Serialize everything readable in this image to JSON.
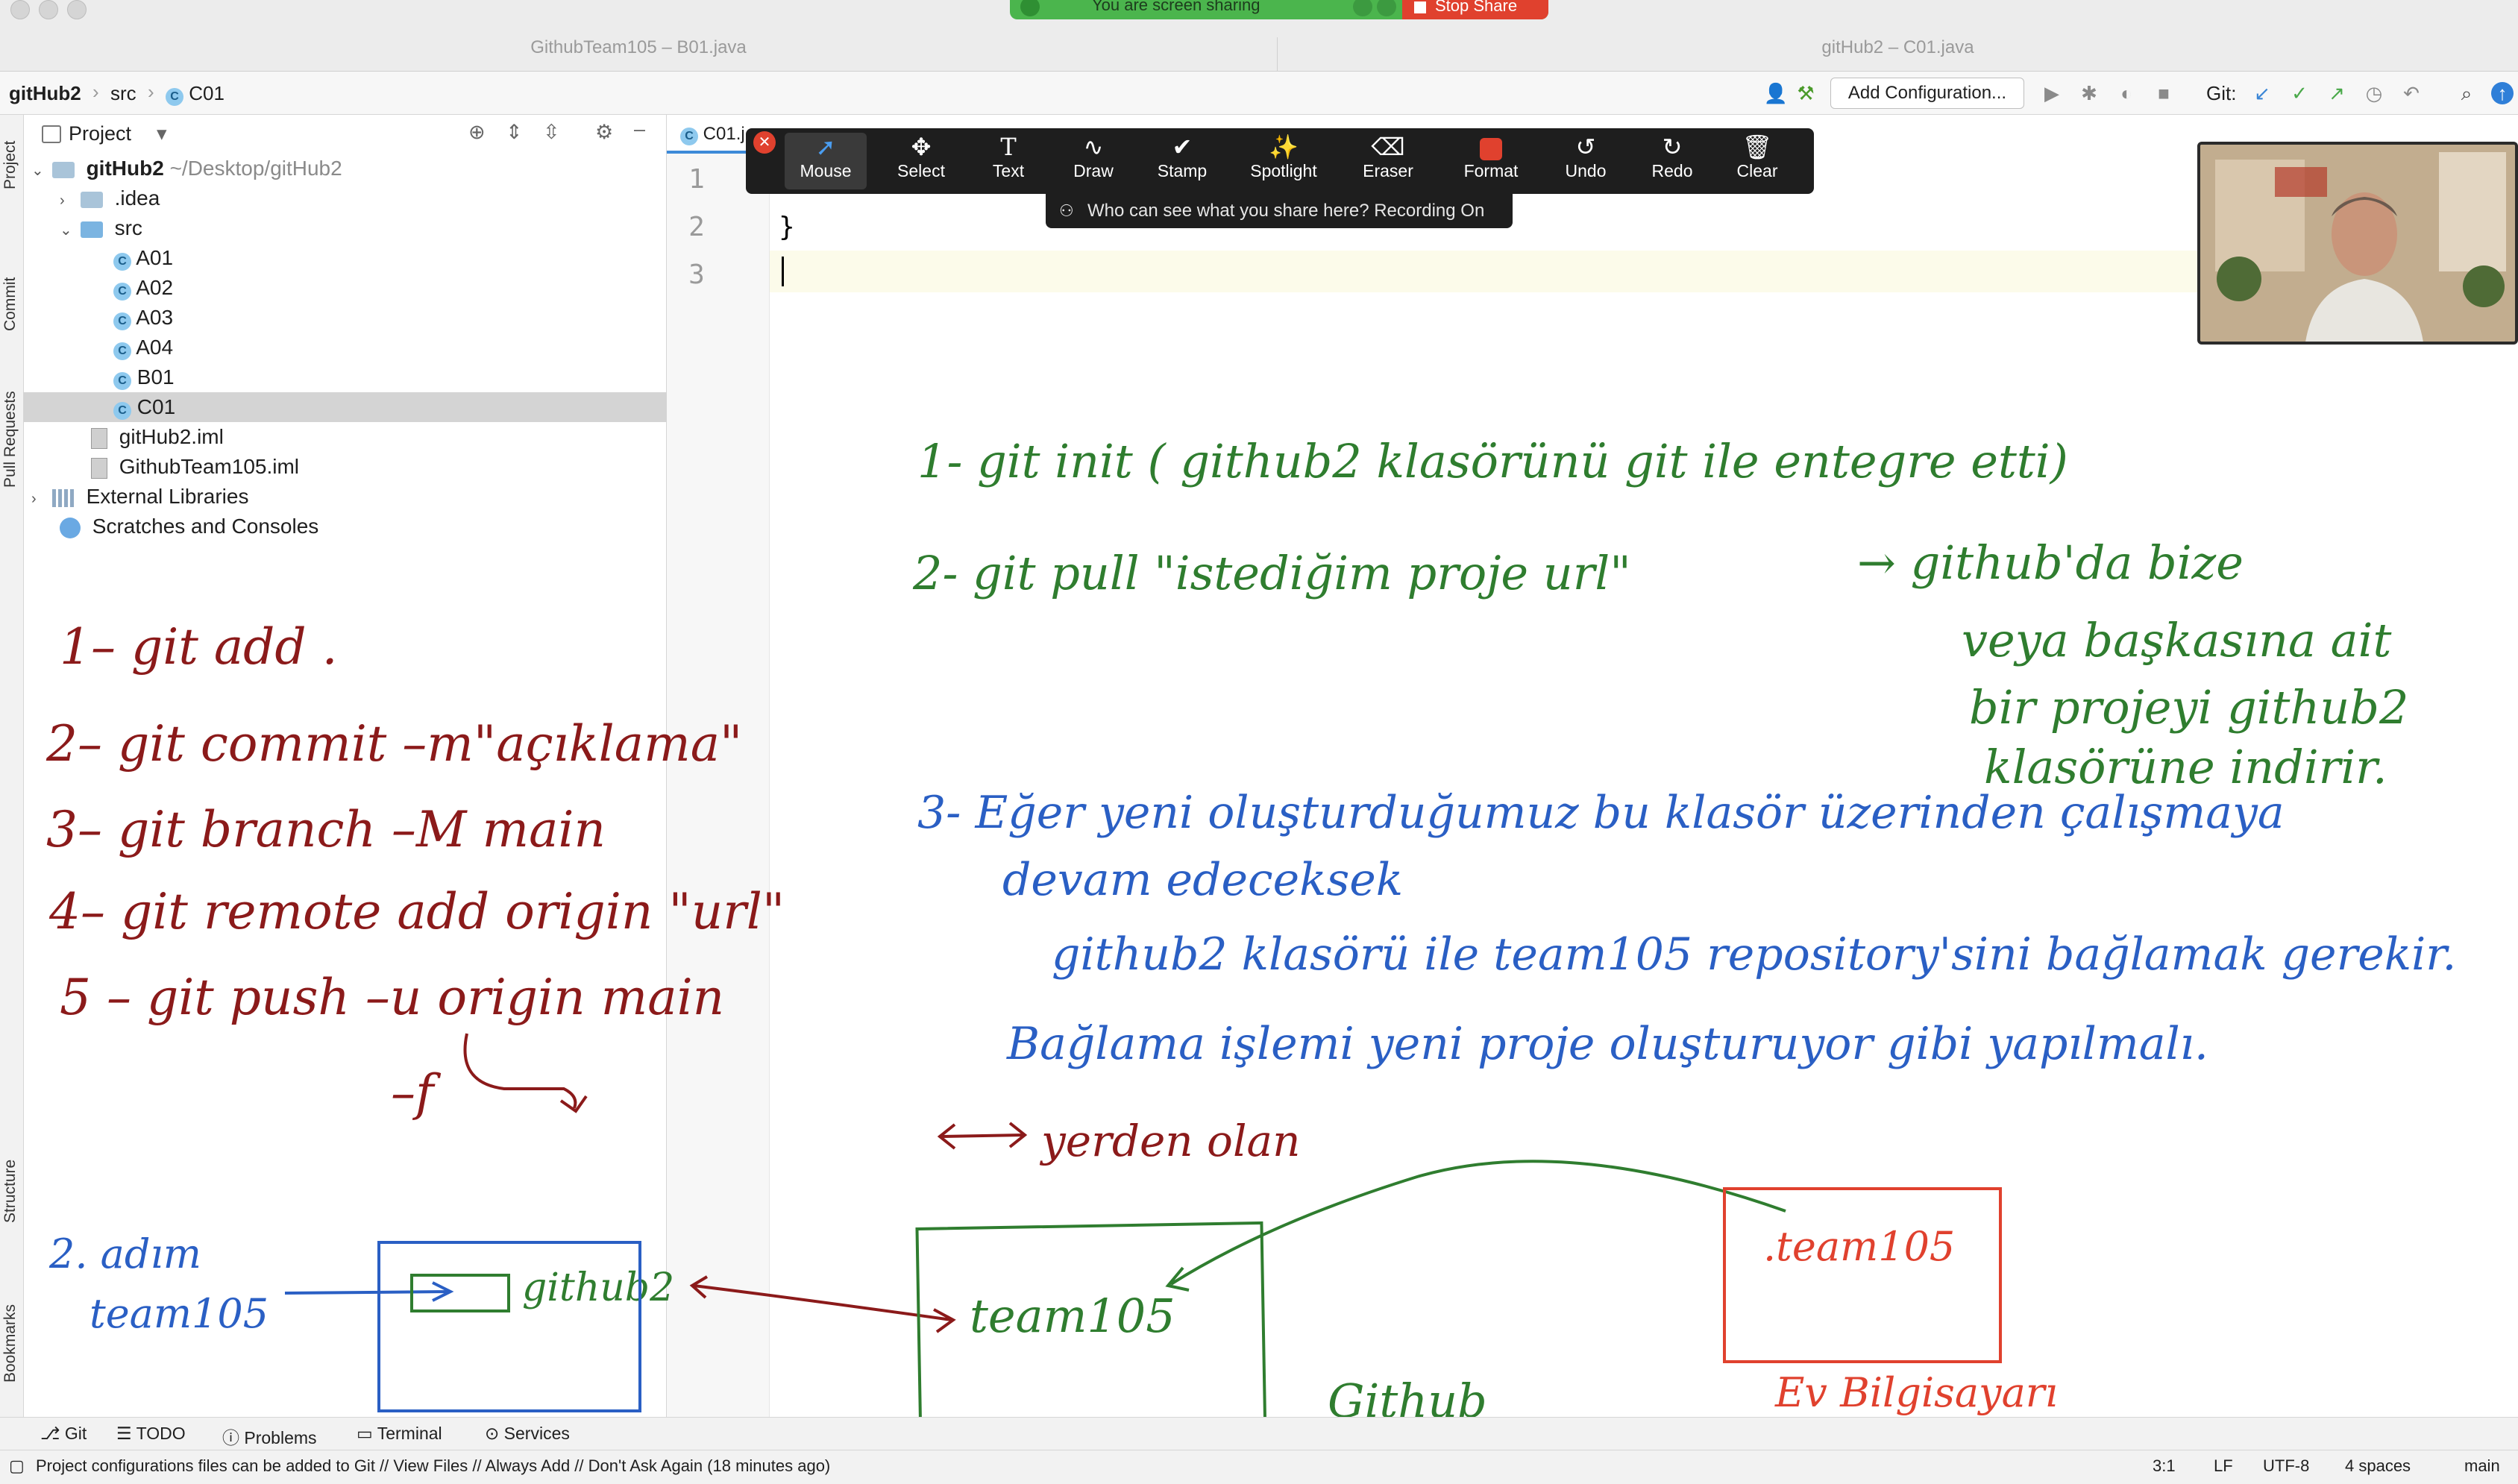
{
  "window": {
    "title_left": "GithubTeam105 – B01.java",
    "title_right": "gitHub2 – C01.java"
  },
  "share": {
    "banner_text": "You are screen sharing",
    "stop_label": "Stop Share"
  },
  "navbar": {
    "crumbs": [
      "gitHub2",
      "src",
      "C01"
    ],
    "run_config": "Add Configuration...",
    "git_label": "Git:"
  },
  "stripe": {
    "tabs": [
      "Project",
      "Commit",
      "Pull Requests",
      "Structure",
      "Bookmarks"
    ]
  },
  "project": {
    "header": "Project",
    "tree": [
      {
        "label": "gitHub2",
        "hint": "~/Desktop/gitHub2"
      },
      {
        "label": ".idea"
      },
      {
        "label": "src"
      },
      {
        "label": "A01"
      },
      {
        "label": "A02"
      },
      {
        "label": "A03"
      },
      {
        "label": "A04"
      },
      {
        "label": "B01"
      },
      {
        "label": "C01"
      },
      {
        "label": "gitHub2.iml"
      },
      {
        "label": "GithubTeam105.iml"
      },
      {
        "label": "External Libraries"
      },
      {
        "label": "Scratches and Consoles"
      }
    ]
  },
  "editor": {
    "tab": "C01.j",
    "lines": [
      {
        "no": "1",
        "code": ""
      },
      {
        "no": "2",
        "code": "}"
      },
      {
        "no": "3",
        "code": ""
      }
    ]
  },
  "annotate": {
    "tools": [
      "Mouse",
      "Select",
      "Text",
      "Draw",
      "Stamp",
      "Spotlight",
      "Eraser",
      "Format",
      "Undo",
      "Redo",
      "Clear"
    ],
    "notice": "Who can see what you share here? Recording On"
  },
  "toolwindows": {
    "items": [
      "Git",
      "TODO",
      "Problems",
      "Terminal",
      "Services"
    ]
  },
  "status": {
    "message": "Project configurations files can be added to Git // View Files // Always Add // Don't Ask Again (18 minutes ago)",
    "position": "3:1",
    "line_sep": "LF",
    "encoding": "UTF-8",
    "indent": "4 spaces",
    "branch": "main"
  },
  "ink": {
    "left": [
      "1– git add .",
      "2– git commit –m\"açıklama\"",
      "3– git branch –M main",
      "4– git remote add origin \"url\"",
      "5 – git push –u origin main",
      "–f"
    ],
    "left_bottom": [
      "2. adım",
      "team105",
      "github2",
      "gitHub2"
    ],
    "green": [
      "1- git init ( github2 klasörünü git ile entegre etti)",
      "2- git pull \"istediğim proje url\"",
      "→ github'da bize",
      "veya başkasına ait",
      "bir projeyi github2",
      "klasörüne indirir.",
      "team105",
      "Github"
    ],
    "blue": [
      "3- Eğer yeni oluşturduğumuz bu klasör üzerinden çalışmaya",
      "devam edeceksek",
      "github2 klasörü ile team105 repository'sini bağlamak gerekir.",
      "Bağlama işlemi yeni proje oluşturuyor gibi yapılmalı."
    ],
    "maroon": [
      "yerden olan"
    ],
    "red": [
      ".team105",
      "Ev Bilgisayarı"
    ]
  }
}
